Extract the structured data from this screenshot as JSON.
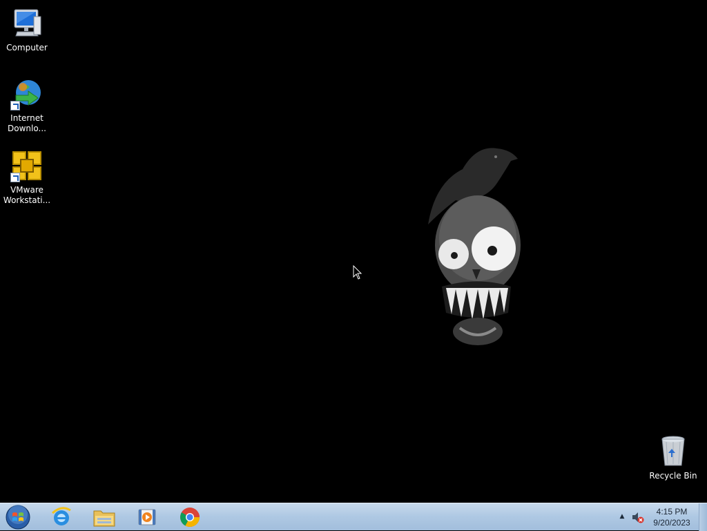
{
  "desktop": {
    "icons": [
      {
        "label": "Computer",
        "icon": "computer-icon"
      },
      {
        "label": "Internet\nDownlo...",
        "icon": "internet-download-manager-icon",
        "shortcut": true
      },
      {
        "label": "VMware\nWorkstati...",
        "icon": "vmware-workstation-icon",
        "shortcut": true
      },
      {
        "label": "Recycle Bin",
        "icon": "recycle-bin-icon"
      }
    ],
    "wallpaper": "skull-with-crow-wallpaper",
    "background_color": "#000000"
  },
  "taskbar": {
    "start": {
      "icon": "windows-start-orb-icon"
    },
    "pinned": [
      {
        "icon": "internet-explorer-icon"
      },
      {
        "icon": "file-explorer-icon"
      },
      {
        "icon": "media-player-icon"
      },
      {
        "icon": "chrome-icon"
      }
    ],
    "tray": {
      "overflow_icon": "chevron-up-icon",
      "volume_icon": "volume-muted-icon"
    },
    "clock": {
      "time": "4:15 PM",
      "date": "9/20/2023"
    },
    "colors": {
      "bar": "#aec8e3"
    }
  }
}
